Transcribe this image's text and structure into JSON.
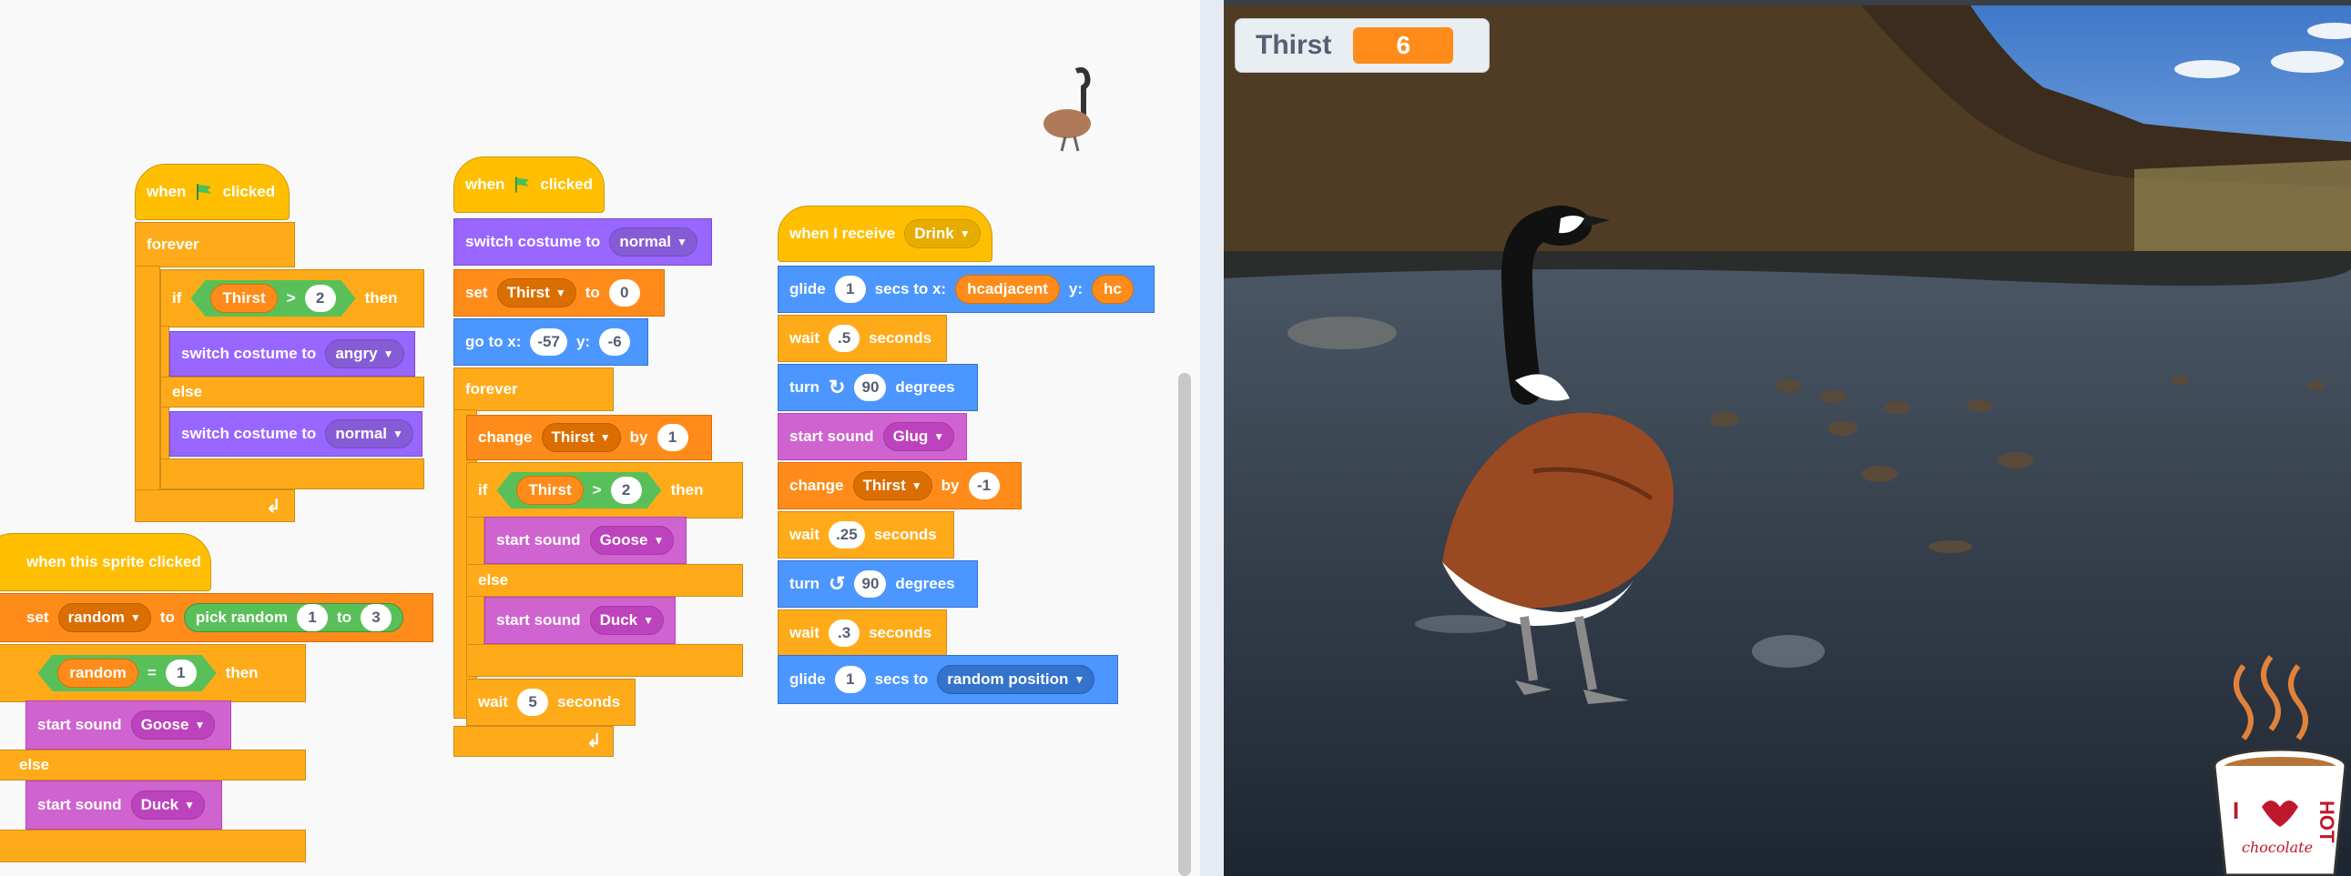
{
  "colors": {
    "events": "#ffbf00",
    "control": "#ffab19",
    "looks": "#9966ff",
    "sound": "#cf63cf",
    "motion": "#4c97ff",
    "variables": "#ff8c1a",
    "operators": "#59c059"
  },
  "script1": {
    "hat_when": "when",
    "hat_clicked": "clicked",
    "forever": "forever",
    "if": "if",
    "then": "then",
    "cond_var": "Thirst",
    "cond_op": ">",
    "cond_val": "2",
    "costume1_text": "switch costume to",
    "costume1_val": "angry",
    "else": "else",
    "costume2_text": "switch costume to",
    "costume2_val": "normal"
  },
  "script2": {
    "hat_when": "when",
    "hat_clicked": "clicked",
    "costume_text": "switch costume to",
    "costume_val": "normal",
    "set_text": "set",
    "set_var": "Thirst",
    "set_to": "to",
    "set_val": "0",
    "goto_text": "go to x:",
    "goto_x": "-57",
    "goto_y_label": "y:",
    "goto_y": "-6",
    "forever": "forever",
    "change_text": "change",
    "change_var": "Thirst",
    "change_by": "by",
    "change_val": "1",
    "if": "if",
    "then": "then",
    "cond_var": "Thirst",
    "cond_op": ">",
    "cond_val": "2",
    "sound1_text": "start sound",
    "sound1_val": "Goose",
    "else": "else",
    "sound2_text": "start sound",
    "sound2_val": "Duck",
    "wait_text": "wait",
    "wait_val": "5",
    "wait_unit": "seconds"
  },
  "script3": {
    "hat_text": "when I receive",
    "hat_val": "Drink",
    "glide1_text": "glide",
    "glide1_secs": "1",
    "glide1_mid": "secs to x:",
    "glide1_x": "hcadjacent",
    "glide1_y_label": "y:",
    "glide1_y": "hc",
    "wait1_text": "wait",
    "wait1_val": ".5",
    "wait1_unit": "seconds",
    "turn1_text": "turn",
    "turn1_val": "90",
    "turn1_unit": "degrees",
    "sound_text": "start sound",
    "sound_val": "Glug",
    "change_text": "change",
    "change_var": "Thirst",
    "change_by": "by",
    "change_val": "-1",
    "wait2_text": "wait",
    "wait2_val": ".25",
    "wait2_unit": "seconds",
    "turn2_text": "turn",
    "turn2_val": "90",
    "turn2_unit": "degrees",
    "wait3_text": "wait",
    "wait3_val": ".3",
    "wait3_unit": "seconds",
    "glide2_text": "glide",
    "glide2_secs": "1",
    "glide2_mid": "secs to",
    "glide2_target": "random position"
  },
  "script4": {
    "hat_text": "when this sprite clicked",
    "set_text": "set",
    "set_var": "random",
    "set_to": "to",
    "pick_text": "pick random",
    "pick_from": "1",
    "pick_to_label": "to",
    "pick_to": "3",
    "if": "if",
    "then": "then",
    "cond_var": "random",
    "cond_op": "=",
    "cond_val": "1",
    "sound1_text": "start sound",
    "sound1_val": "Goose",
    "else": "else",
    "sound2_text": "start sound",
    "sound2_val": "Duck"
  },
  "stage": {
    "monitor_label": "Thirst",
    "monitor_value": "6",
    "mug_text_i": "I",
    "mug_text_hot": "HOT",
    "mug_text_choc": "chocolate"
  }
}
